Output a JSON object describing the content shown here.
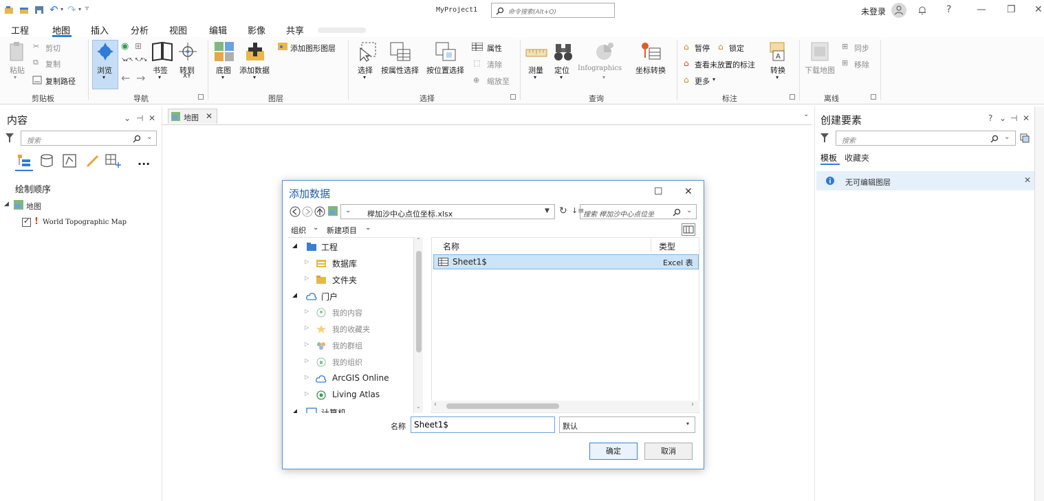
{
  "app": {
    "project_title": "MyProject1",
    "command_search_placeholder": "命令搜索(Alt+Q)",
    "login_text": "未登录"
  },
  "menu": {
    "tabs": [
      "工程",
      "地图",
      "插入",
      "分析",
      "视图",
      "编辑",
      "影像",
      "共享"
    ],
    "active_tab": "地图"
  },
  "ribbon": {
    "clipboard": {
      "paste": "粘贴",
      "cut": "剪切",
      "copy": "复制",
      "copy_path": "复制路径",
      "label": "剪贴板"
    },
    "navigate": {
      "explore": "浏览",
      "bookmarks": "书签",
      "goto_xy_line1": "转到",
      "goto_xy_line2": "XY",
      "label": "导航"
    },
    "layer": {
      "basemap": "底图",
      "add_data": "添加数据",
      "add_graphics_layer": "添加图形图层",
      "label": "图层"
    },
    "selection": {
      "select": "选择",
      "select_by_attr": "按属性选择",
      "select_by_loc": "按位置选择",
      "attributes": "属性",
      "clear": "清除",
      "zoom_to": "缩放至",
      "label": "选择"
    },
    "inquiry": {
      "measure": "测量",
      "locate": "定位",
      "infographics": "Infographics",
      "convert_coords": "坐标转换",
      "label": "查询"
    },
    "labeling": {
      "pause": "暂停",
      "lock": "锁定",
      "view_unplaced": "查看未放置的标注",
      "more": "更多",
      "convert": "转换",
      "label": "标注"
    },
    "offline": {
      "download_map": "下载地图",
      "sync": "同步",
      "remove": "移除",
      "label": "离线"
    }
  },
  "contents_panel": {
    "title": "内容",
    "search_placeholder": "搜索",
    "more": "...",
    "draw_order": "绘制顺序",
    "map_layer": "地图",
    "world_layer": "World Topographic Map"
  },
  "map_view": {
    "tab_label": "地图"
  },
  "create_features_panel": {
    "title": "创建要素",
    "search_placeholder": "搜索",
    "tabs": [
      "模板",
      "收藏夹"
    ],
    "info_text": "无可编辑图层"
  },
  "dialog": {
    "title": "添加数据",
    "address": "榉加沙中心点位坐标.xlsx",
    "search_placeholder": "搜索 榉加沙中心点位坐",
    "organize": "组织",
    "new_item": "新建项目",
    "tree": [
      {
        "label": "工程",
        "level": 0,
        "dim": false
      },
      {
        "label": "数据库",
        "level": 1,
        "dim": false
      },
      {
        "label": "文件夹",
        "level": 1,
        "dim": false
      },
      {
        "label": "门户",
        "level": 0,
        "dim": false
      },
      {
        "label": "我的内容",
        "level": 1,
        "dim": true
      },
      {
        "label": "我的收藏夹",
        "level": 1,
        "dim": true
      },
      {
        "label": "我的群组",
        "level": 1,
        "dim": true
      },
      {
        "label": "我的组织",
        "level": 1,
        "dim": true
      },
      {
        "label": "ArcGIS Online",
        "level": 1,
        "dim": false
      },
      {
        "label": "Living Atlas",
        "level": 1,
        "dim": false
      },
      {
        "label": "计算机",
        "level": 0,
        "dim": false
      }
    ],
    "columns": {
      "name": "名称",
      "type": "类型"
    },
    "rows": [
      {
        "name": "Sheet1$",
        "type": "Excel 表"
      }
    ],
    "name_label": "名称",
    "name_value": "Sheet1$",
    "filter_value": "默认",
    "ok": "确定",
    "cancel": "取消"
  }
}
